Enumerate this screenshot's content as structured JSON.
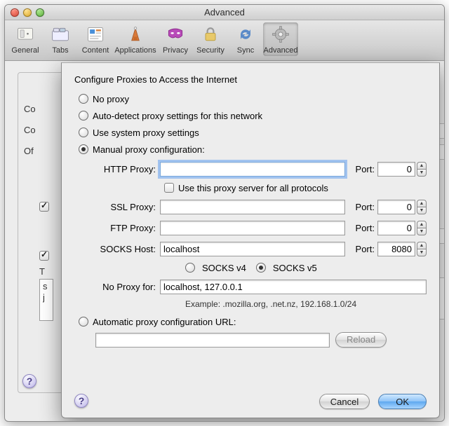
{
  "window": {
    "title": "Advanced"
  },
  "toolbar": {
    "items": [
      {
        "label": "General"
      },
      {
        "label": "Tabs"
      },
      {
        "label": "Content"
      },
      {
        "label": "Applications"
      },
      {
        "label": "Privacy"
      },
      {
        "label": "Security"
      },
      {
        "label": "Sync"
      },
      {
        "label": "Advanced"
      }
    ]
  },
  "back": {
    "l1": "Co",
    "l2": "Co",
    "l3": "Of",
    "l4": "T",
    "ta1": "s",
    "ta2": "j"
  },
  "sheet": {
    "heading": "Configure Proxies to Access the Internet",
    "opts": {
      "no_proxy": "No proxy",
      "auto_detect": "Auto-detect proxy settings for this network",
      "system": "Use system proxy settings",
      "manual": "Manual proxy configuration:",
      "auto_url": "Automatic proxy configuration URL:"
    },
    "labels": {
      "http": "HTTP Proxy:",
      "ssl": "SSL Proxy:",
      "ftp": "FTP Proxy:",
      "socks": "SOCKS Host:",
      "port": "Port:",
      "use_all": "Use this proxy server for all protocols",
      "socks_v4": "SOCKS v4",
      "socks_v5": "SOCKS v5",
      "noproxy_for": "No Proxy for:",
      "example": "Example: .mozilla.org, .net.nz, 192.168.1.0/24"
    },
    "values": {
      "http_host": "",
      "http_port": "0",
      "ssl_host": "",
      "ssl_port": "0",
      "ftp_host": "",
      "ftp_port": "0",
      "socks_host": "localhost",
      "socks_port": "8080",
      "noproxy": "localhost, 127.0.0.1",
      "auto_url": ""
    },
    "buttons": {
      "reload": "Reload",
      "cancel": "Cancel",
      "ok": "OK"
    }
  }
}
